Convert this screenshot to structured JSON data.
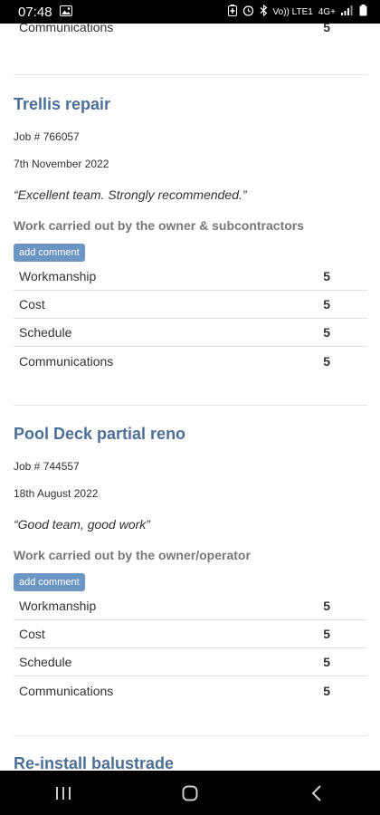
{
  "status_bar": {
    "time": "07:48",
    "network": "Vo)) LTE1",
    "signal_type": "4G+"
  },
  "partial_row": {
    "label": "Communications",
    "score": "5"
  },
  "jobs": [
    {
      "title": "Trellis repair",
      "job_number": "Job # 766057",
      "date": "7th November 2022",
      "quote": "“Excellent team. Strongly recommended.”",
      "carried_out": "Work carried out by the owner & subcontractors",
      "button_label": "add comment",
      "ratings": [
        {
          "label": "Workmanship",
          "score": "5"
        },
        {
          "label": "Cost",
          "score": "5"
        },
        {
          "label": "Schedule",
          "score": "5"
        },
        {
          "label": "Communications",
          "score": "5"
        }
      ]
    },
    {
      "title": "Pool Deck partial reno",
      "job_number": "Job # 744557",
      "date": "18th August 2022",
      "quote": "“Good team, good work”",
      "carried_out": "Work carried out by the owner/operator",
      "button_label": "add comment",
      "ratings": [
        {
          "label": "Workmanship",
          "score": "5"
        },
        {
          "label": "Cost",
          "score": "5"
        },
        {
          "label": "Schedule",
          "score": "5"
        },
        {
          "label": "Communications",
          "score": "5"
        }
      ]
    },
    {
      "title": "Re-install balustrade"
    }
  ],
  "icons": {
    "status_left": [
      "image-icon"
    ],
    "status_right": [
      "battery-saver-icon",
      "alarm-icon",
      "bluetooth-icon",
      "signal-icon",
      "battery-icon"
    ],
    "nav": [
      "recents-icon",
      "home-icon",
      "back-icon"
    ]
  },
  "colors": {
    "title": "#4d6f96",
    "button": "#6b95c2",
    "carried_out": "#777777"
  }
}
